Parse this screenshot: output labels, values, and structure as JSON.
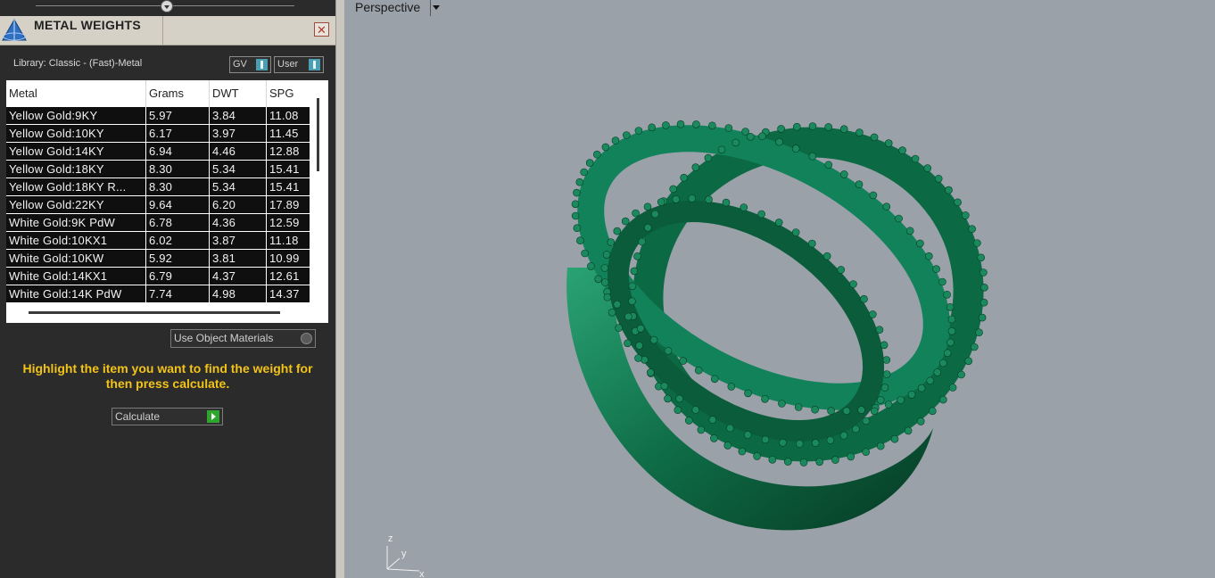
{
  "panel": {
    "title": "METAL WEIGHTS",
    "close_label": "✕",
    "library_label": "Library: Classic - (Fast)-Metal",
    "toggles": {
      "gv": "GV",
      "user": "User"
    },
    "table": {
      "columns": [
        "Metal",
        "Grams",
        "DWT",
        "SPG"
      ],
      "rows": [
        [
          "Yellow Gold:9KY",
          "5.97",
          "3.84",
          "11.08"
        ],
        [
          "Yellow Gold:10KY",
          "6.17",
          "3.97",
          "11.45"
        ],
        [
          "Yellow Gold:14KY",
          "6.94",
          "4.46",
          "12.88"
        ],
        [
          "Yellow Gold:18KY",
          "8.30",
          "5.34",
          "15.41"
        ],
        [
          "Yellow Gold:18KY R...",
          "8.30",
          "5.34",
          "15.41"
        ],
        [
          "Yellow Gold:22KY",
          "9.64",
          "6.20",
          "17.89"
        ],
        [
          "White Gold:9K PdW",
          "6.78",
          "4.36",
          "12.59"
        ],
        [
          "White Gold:10KX1",
          "6.02",
          "3.87",
          "11.18"
        ],
        [
          "White Gold:10KW",
          "5.92",
          "3.81",
          "10.99"
        ],
        [
          "White Gold:14KX1",
          "6.79",
          "4.37",
          "12.61"
        ],
        [
          "White Gold:14K PdW",
          "7.74",
          "4.98",
          "14.37"
        ]
      ]
    },
    "use_object_materials": "Use Object Materials",
    "hint": "Highlight the item you want to find the weight for then press calculate.",
    "calculate_label": "Calculate"
  },
  "viewport": {
    "label": "Perspective",
    "axis": {
      "z": "z",
      "y": "y",
      "x": "x"
    }
  },
  "colors": {
    "panel_bg": "#2b2b2b",
    "hint_text": "#f2c318",
    "toggle_knob": "#4a9fb3",
    "calc_knob": "#2fa52f",
    "ring": "#0e6b45",
    "viewport_bg": "#9aa1a9"
  }
}
